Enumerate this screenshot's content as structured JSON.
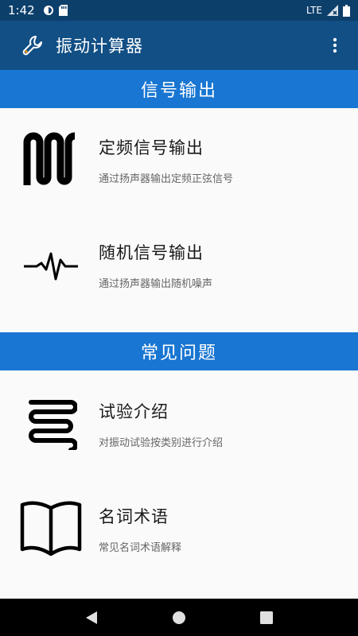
{
  "status_bar": {
    "time": "1:42",
    "network": "LTE"
  },
  "app_bar": {
    "title": "振动计算器",
    "icon": "wrench-icon",
    "menu_icon": "more-vert-icon"
  },
  "sections": [
    {
      "header": "信号输出",
      "items": [
        {
          "title": "定频信号输出",
          "subtitle": "通过扬声器输出定频正弦信号",
          "icon": "square-wave-icon"
        },
        {
          "title": "随机信号输出",
          "subtitle": "通过扬声器输出随机噪声",
          "icon": "noise-pulse-icon"
        }
      ]
    },
    {
      "header": "常见问题",
      "items": [
        {
          "title": "试验介绍",
          "subtitle": "对振动试验按类别进行介绍",
          "icon": "coil-icon"
        },
        {
          "title": "名词术语",
          "subtitle": "常见名词术语解释",
          "icon": "book-icon"
        }
      ]
    }
  ],
  "nav_bar": [
    "back-icon",
    "home-icon",
    "recents-icon"
  ],
  "colors": {
    "status_bar": "#0d3f6b",
    "app_bar": "#114f85",
    "section_header": "#1976d2",
    "background": "#fafafa"
  }
}
